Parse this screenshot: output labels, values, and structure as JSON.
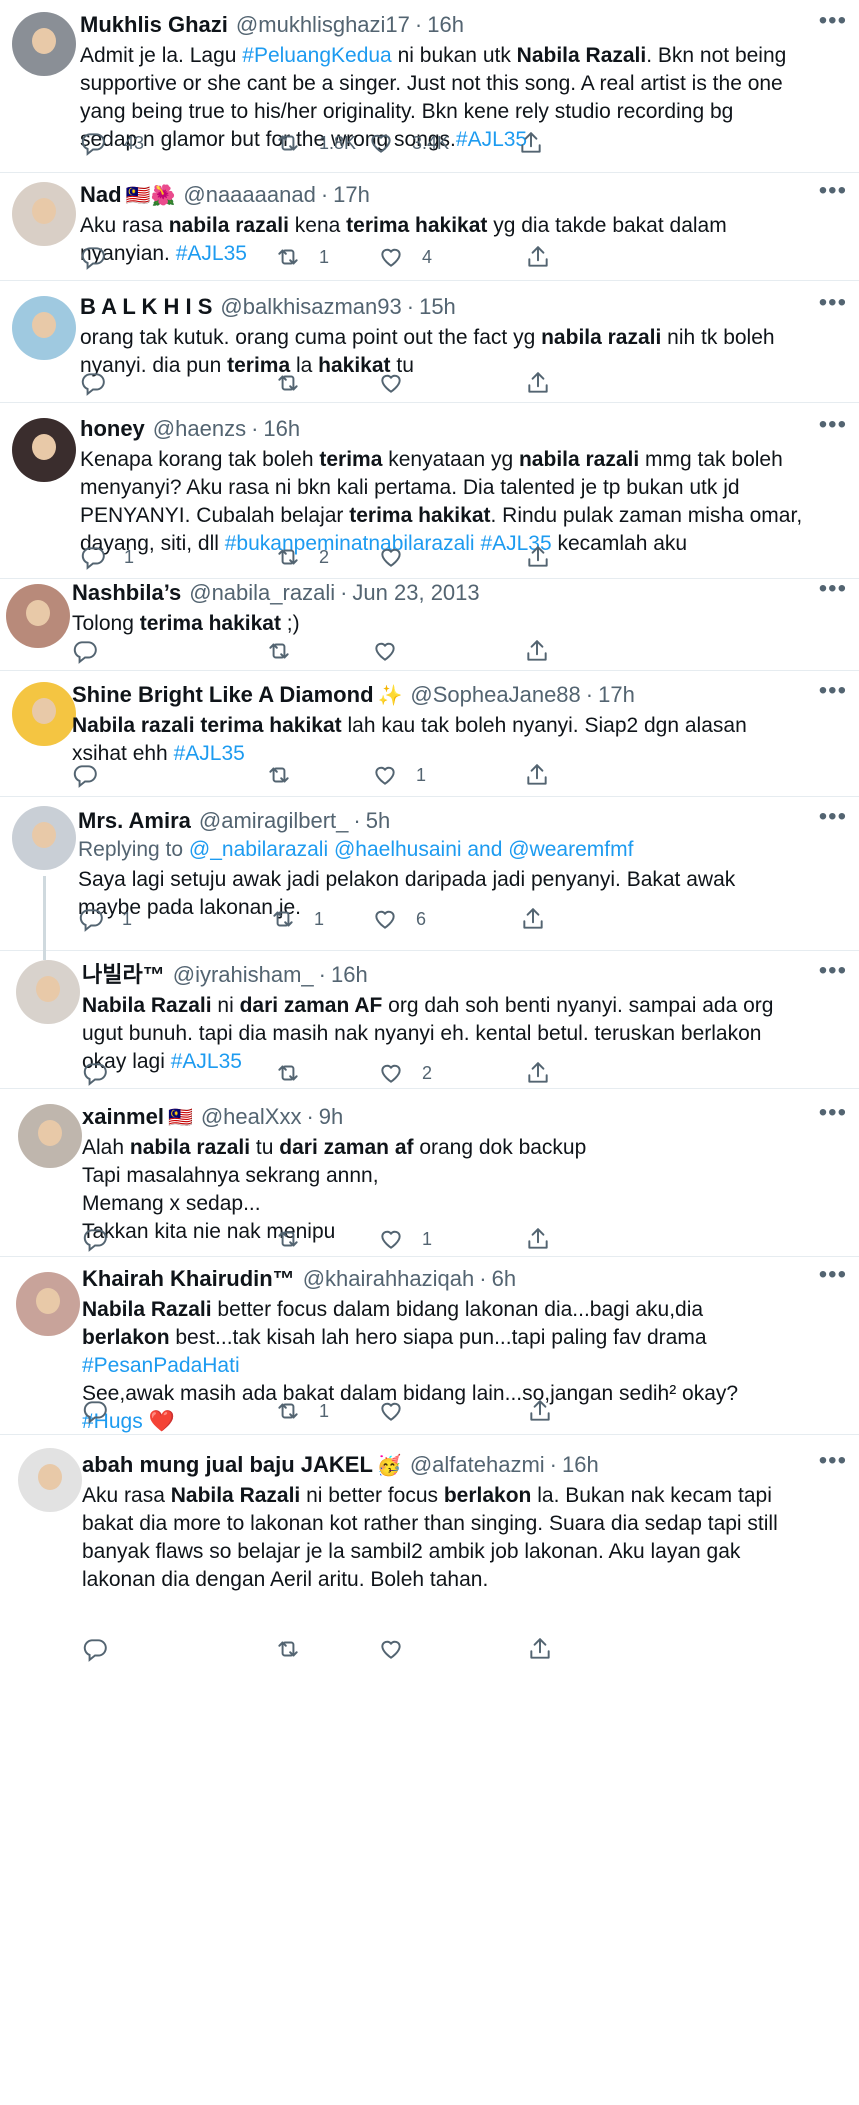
{
  "tweets": [
    {
      "name": "Mukhlis Ghazi",
      "flag": "",
      "handle": "@mukhlisghazi17",
      "time": "16h",
      "avatar_color": "#8a8f96",
      "lines": [
        [
          {
            "t": "Admit je la. Lagu "
          },
          {
            "t": "#PeluangKedua",
            "c": "ht"
          },
          {
            "t": " ni bukan utk "
          },
          {
            "t": "Nabila Razali",
            "b": true
          },
          {
            "t": ". Bkn not being"
          }
        ],
        [
          {
            "t": "supportive or she cant be a singer. Just not this song. A real artist is the one"
          }
        ],
        [
          {
            "t": "yang being true to his/her originality. Bkn kene rely studio recording bg"
          }
        ],
        [
          {
            "t": "sedap n glamor but for the wrong songs."
          },
          {
            "t": "#AJL35",
            "c": "ht"
          }
        ]
      ],
      "replies": "43",
      "retweets": "1.8K",
      "likes": "3.4K"
    },
    {
      "name": "Nad",
      "flag": "🇲🇾🌺",
      "handle": "@naaaaanad",
      "time": "17h",
      "avatar_color": "#d9cfc6",
      "lines": [
        [
          {
            "t": "Aku rasa "
          },
          {
            "t": "nabila razali",
            "b": true
          },
          {
            "t": " kena "
          },
          {
            "t": "terima hakikat",
            "b": true
          },
          {
            "t": " yg dia takde bakat dalam"
          }
        ],
        [
          {
            "t": "nyanyian. "
          },
          {
            "t": "#AJL35",
            "c": "ht"
          }
        ]
      ],
      "replies": "",
      "retweets": "1",
      "likes": "4"
    },
    {
      "name": "B A L K H I S",
      "flag": "",
      "handle": "@balkhisazman93",
      "time": "15h",
      "avatar_color": "#9fc9e0",
      "lines": [
        [
          {
            "t": "orang tak kutuk. orang cuma point out the fact yg "
          },
          {
            "t": "nabila razali",
            "b": true
          },
          {
            "t": " nih tk boleh"
          }
        ],
        [
          {
            "t": "nyanyi. dia pun "
          },
          {
            "t": "terima",
            "b": true
          },
          {
            "t": " la "
          },
          {
            "t": "hakikat",
            "b": true
          },
          {
            "t": " tu"
          }
        ]
      ],
      "replies": "",
      "retweets": "",
      "likes": ""
    },
    {
      "name": "honey",
      "flag": "",
      "handle": "@haenzs",
      "time": "16h",
      "avatar_color": "#3a2d2d",
      "lines": [
        [
          {
            "t": "Kenapa korang tak boleh "
          },
          {
            "t": "terima",
            "b": true
          },
          {
            "t": " kenyataan yg "
          },
          {
            "t": "nabila razali",
            "b": true
          },
          {
            "t": " mmg tak boleh"
          }
        ],
        [
          {
            "t": "menyanyi? Aku rasa ni bkn kali pertama. Dia talented je tp bukan utk jd"
          }
        ],
        [
          {
            "t": "PENYANYI. Cubalah belajar "
          },
          {
            "t": "terima hakikat",
            "b": true
          },
          {
            "t": ". Rindu pulak zaman misha omar,"
          }
        ],
        [
          {
            "t": "dayang, siti, dll "
          },
          {
            "t": "#bukanpeminatnabilarazali",
            "c": "ht"
          },
          {
            "t": " "
          },
          {
            "t": "#AJL35",
            "c": "ht"
          },
          {
            "t": " kecamlah aku"
          }
        ]
      ],
      "replies": "1",
      "retweets": "2",
      "likes": ""
    },
    {
      "name": "Nashbila’s",
      "flag": "",
      "handle": "@nabila_razali",
      "time": "Jun 23, 2013",
      "avatar_color": "#b88a7a",
      "lines": [
        [
          {
            "t": "Tolong "
          },
          {
            "t": "terima hakikat",
            "b": true
          },
          {
            "t": " ;)"
          }
        ]
      ],
      "replies": "",
      "retweets": "",
      "likes": ""
    },
    {
      "name": "Shine Bright Like A Diamond",
      "flag": "✨",
      "handle": "@SopheaJane88",
      "time": "17h",
      "avatar_color": "#f4c542",
      "lines": [
        [
          {
            "t": "Nabila razali terima hakikat",
            "b": true
          },
          {
            "t": " lah kau tak boleh nyanyi. Siap2 dgn alasan"
          }
        ],
        [
          {
            "t": "xsihat ehh "
          },
          {
            "t": "#AJL35",
            "c": "ht"
          }
        ]
      ],
      "replies": "",
      "retweets": "",
      "likes": "1"
    },
    {
      "name": "Mrs. Amira",
      "flag": "",
      "handle": "@amiragilbert_",
      "time": "5h",
      "avatar_color": "#c9cfd6",
      "replying_prefix": "Replying to ",
      "replying_users": "@_nabilarazali @haelhusaini and @wearemfmf",
      "lines": [
        [
          {
            "t": "Saya lagi setuju awak jadi pelakon daripada jadi penyanyi. Bakat awak"
          }
        ],
        [
          {
            "t": "maybe pada lakonan je."
          }
        ]
      ],
      "replies": "1",
      "retweets": "1",
      "likes": "6"
    },
    {
      "name": "나빌라™",
      "flag": "",
      "handle": "@iyrahisham_",
      "time": "16h",
      "avatar_color": "#d8d2cc",
      "lines": [
        [
          {
            "t": "Nabila Razali",
            "b": true
          },
          {
            "t": " ni "
          },
          {
            "t": "dari zaman AF",
            "b": true
          },
          {
            "t": " org dah soh benti nyanyi. sampai ada org"
          }
        ],
        [
          {
            "t": "ugut bunuh. tapi dia masih nak nyanyi eh. kental betul. teruskan berlakon"
          }
        ],
        [
          {
            "t": "okay lagi "
          },
          {
            "t": "#AJL35",
            "c": "ht"
          }
        ]
      ],
      "replies": "",
      "retweets": "",
      "likes": "2"
    },
    {
      "name": "xainmel",
      "flag": "🇲🇾",
      "handle": "@healXxx",
      "time": "9h",
      "avatar_color": "#bfb6ad",
      "lines": [
        [
          {
            "t": "Alah "
          },
          {
            "t": "nabila razali",
            "b": true
          },
          {
            "t": " tu "
          },
          {
            "t": "dari zaman af",
            "b": true
          },
          {
            "t": " orang dok backup"
          }
        ],
        [
          {
            "t": "Tapi masalahnya sekrang annn,"
          }
        ],
        [
          {
            "t": "Memang x sedap..."
          }
        ],
        [
          {
            "t": "Takkan kita nie nak menipu"
          }
        ]
      ],
      "replies": "",
      "retweets": "",
      "likes": "1"
    },
    {
      "name": "Khairah Khairudin™",
      "flag": "",
      "handle": "@khairahhaziqah",
      "time": "6h",
      "avatar_color": "#c8a39a",
      "lines": [
        [
          {
            "t": "Nabila Razali",
            "b": true
          },
          {
            "t": " better focus dalam bidang lakonan dia...bagi aku,dia"
          }
        ],
        [
          {
            "t": "berlakon",
            "b": true
          },
          {
            "t": " best...tak kisah lah hero siapa pun...tapi paling fav drama"
          }
        ],
        [
          {
            "t": "#PesanPadaHati",
            "c": "ht"
          }
        ],
        [
          {
            "t": "See,awak masih ada bakat dalam bidang lain...so,jangan sedih² okay?"
          }
        ],
        [
          {
            "t": "#Hugs",
            "c": "ht"
          },
          {
            "t": " "
          },
          {
            "t": "❤️",
            "c": "heart-emoji"
          }
        ]
      ],
      "replies": "",
      "retweets": "1",
      "likes": ""
    },
    {
      "name": "abah mung jual baju JAKEL",
      "flag": "🥳",
      "handle": "@alfatehazmi",
      "time": "16h",
      "avatar_color": "#e2e2e2",
      "lines": [
        [
          {
            "t": "Aku rasa "
          },
          {
            "t": "Nabila Razali",
            "b": true
          },
          {
            "t": " ni better focus "
          },
          {
            "t": "berlakon",
            "b": true
          },
          {
            "t": " la. Bukan nak kecam tapi"
          }
        ],
        [
          {
            "t": "bakat dia more to lakonan kot rather than singing. Suara dia sedap tapi still"
          }
        ],
        [
          {
            "t": "banyak flaws so belajar je la sambil2 ambik job lakonan. Aku layan gak"
          }
        ],
        [
          {
            "t": "lakonan dia dengan Aeril aritu. Boleh tahan."
          }
        ]
      ],
      "replies": "",
      "retweets": "",
      "likes": ""
    }
  ],
  "icons": {
    "reply": "reply-icon",
    "retweet": "retweet-icon",
    "like": "heart-icon",
    "share": "share-icon",
    "more": "more-icon"
  },
  "colors": {
    "hashtag": "#1d9bf0",
    "secondary": "#536471",
    "divider": "#e6ecf0"
  },
  "more_glyph": "•••",
  "dot": "·"
}
